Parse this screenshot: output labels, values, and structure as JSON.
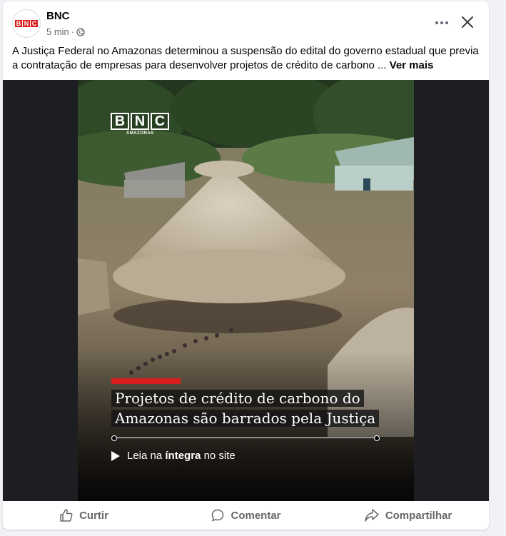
{
  "post": {
    "page_name": "BNC",
    "avatar_text": [
      "B",
      "N",
      "C"
    ],
    "time": "5 min",
    "separator": "·",
    "privacy_icon": "globe-icon",
    "text": "A Justiça Federal no Amazonas determinou a suspensão do edital do governo estadual que previa a contratação de empresas para desenvolver projetos de crédito de carbono ...",
    "see_more": "Ver mais"
  },
  "video": {
    "logo_letters": [
      "B",
      "N",
      "C"
    ],
    "logo_sub": "AMAZONAS",
    "headline_line1": "Projetos de crédito de carbono do",
    "headline_line2": "Amazonas são barrados pela Justiça",
    "cta_prefix": "Leia na ",
    "cta_bold": "íntegra",
    "cta_suffix": " no site"
  },
  "actions": {
    "like": "Curtir",
    "comment": "Comentar",
    "share": "Compartilhar"
  },
  "colors": {
    "brand_red": "#d81e1e",
    "text_secondary": "#65676b"
  }
}
